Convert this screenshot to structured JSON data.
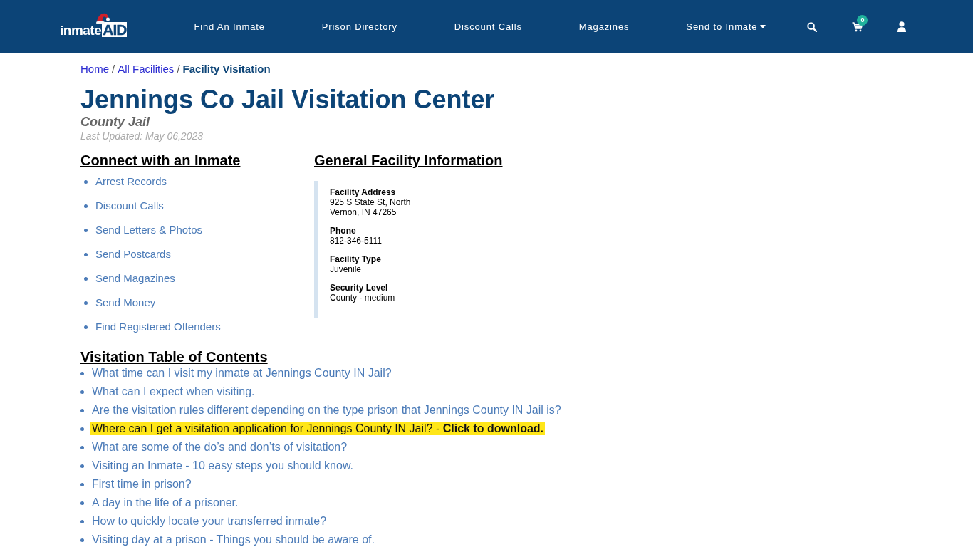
{
  "logo": [
    "inmate",
    "AID"
  ],
  "nav": [
    {
      "label": "Find An Inmate",
      "dropdown": false
    },
    {
      "label": "Prison Directory",
      "dropdown": false
    },
    {
      "label": "Discount Calls",
      "dropdown": false
    },
    {
      "label": "Magazines",
      "dropdown": false
    },
    {
      "label": "Send to Inmate",
      "dropdown": true
    }
  ],
  "cart_count": "0",
  "breadcrumb": {
    "items": [
      {
        "label": "Home",
        "current": false
      },
      {
        "label": "All Facilities",
        "current": false
      },
      {
        "label": "Facility Visitation",
        "current": true
      }
    ],
    "separators": [
      "/",
      "/"
    ]
  },
  "title": "Jennings Co Jail Visitation Center",
  "subtitle": "County Jail",
  "last_updated": "Last Updated: May 06,2023",
  "connect": {
    "heading": "Connect with an Inmate",
    "links": [
      "Arrest Records",
      "Discount Calls",
      "Send Letters & Photos",
      "Send Postcards",
      "Send Magazines",
      "Send Money",
      "Find Registered Offenders"
    ]
  },
  "facility_info": {
    "heading": "General Facility Information",
    "fields": [
      {
        "label": "Facility Address",
        "lines": [
          "925 S State St, North",
          "Vernon, IN 47265"
        ]
      },
      {
        "label": "Phone",
        "lines": [
          "812-346-5111"
        ]
      },
      {
        "label": "Facility Type",
        "lines": [
          "Juvenile"
        ]
      },
      {
        "label": "Security Level",
        "lines": [
          "County - medium"
        ]
      }
    ]
  },
  "toc": {
    "heading": "Visitation Table of Contents",
    "items": [
      {
        "text": "What time can I visit my inmate at Jennings County IN Jail?",
        "highlighted": false
      },
      {
        "text": "What can I expect when visiting.",
        "highlighted": false
      },
      {
        "text": "Are the visitation rules different depending on the type prison that Jennings County IN Jail is?",
        "highlighted": false
      },
      {
        "text": "Where can I get a visitation application for Jennings County IN Jail? - **Click to download.**",
        "highlighted": true
      },
      {
        "text": "What are some of the do’s and don’ts of visitation?",
        "highlighted": false
      },
      {
        "text": "Visiting an Inmate - 10 easy steps you should know.",
        "highlighted": false
      },
      {
        "text": "First time in prison?",
        "highlighted": false
      },
      {
        "text": "A day in the life of a prisoner.",
        "highlighted": false
      },
      {
        "text": "How to quickly locate your transferred inmate?",
        "highlighted": false
      },
      {
        "text": "Visiting day at a prison - Things you should be aware of.",
        "highlighted": false
      }
    ]
  }
}
